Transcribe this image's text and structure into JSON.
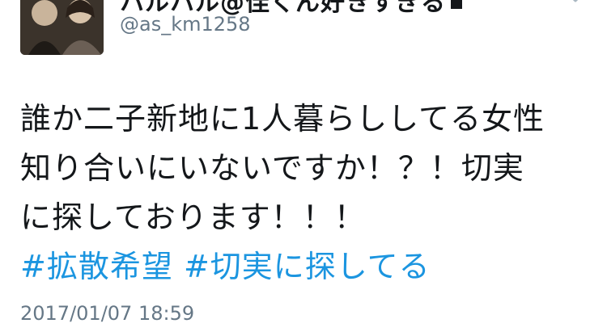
{
  "tweet": {
    "author": {
      "display_name": "ハルハル@佳くん好きすぎる",
      "handle": "@as_km1258"
    },
    "text_lines": [
      "誰か二子新地に1人暮らししてる女性",
      "知り合いにいないですか！？！切実",
      "に探しております！！！"
    ],
    "hashtags": [
      "#拡散希望",
      "#切実に探してる"
    ],
    "timestamp": "2017/01/07 18:59"
  },
  "icons": {
    "lock": "lock-icon",
    "menu": "chevron-down-icon"
  },
  "colors": {
    "text": "#14171a",
    "secondary": "#657786",
    "link": "#1b95e0"
  }
}
